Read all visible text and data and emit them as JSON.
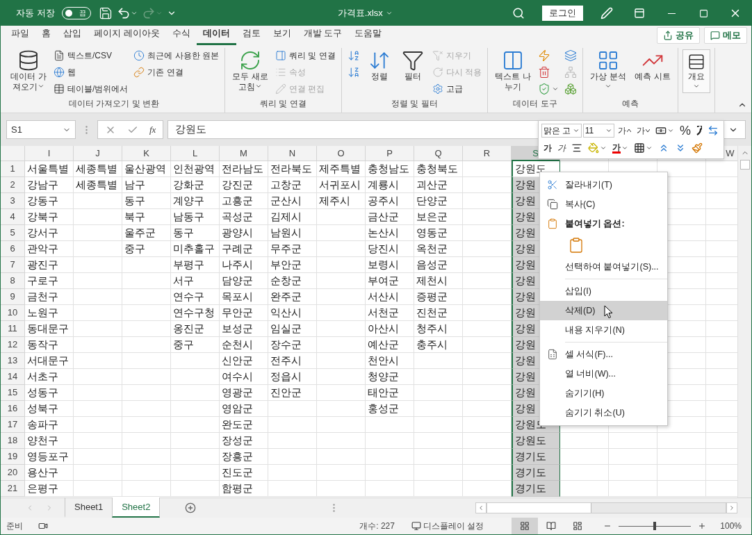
{
  "title_bar": {
    "autosave_label": "자동 저장",
    "autosave": {
      "on": false,
      "label": "끔"
    },
    "redo_disabled": true,
    "title": "가격표.xlsx",
    "login": "로그인"
  },
  "ribbon_tabs": [
    {
      "label": "파일",
      "selected": false
    },
    {
      "label": "홈",
      "selected": false
    },
    {
      "label": "삽입",
      "selected": false
    },
    {
      "label": "페이지 레이아웃",
      "selected": false
    },
    {
      "label": "수식",
      "selected": false
    },
    {
      "label": "데이터",
      "selected": true
    },
    {
      "label": "검토",
      "selected": false
    },
    {
      "label": "보기",
      "selected": false
    },
    {
      "label": "개발 도구",
      "selected": false
    },
    {
      "label": "도움말",
      "selected": false
    }
  ],
  "share": "공유",
  "memo": "메모",
  "ribbon_groups": [
    {
      "label": "데이터 가져오기 및 변환",
      "columns": [
        [
          {
            "kind": "big",
            "label": "데이터 가져오기",
            "dropdown": true,
            "disabled": false
          }
        ],
        [
          {
            "kind": "small",
            "label": "텍스트/CSV",
            "disabled": false
          },
          {
            "kind": "small",
            "label": "웹",
            "disabled": false
          },
          {
            "kind": "small",
            "label": "테이블/범위에서",
            "disabled": false
          }
        ],
        [
          {
            "kind": "small",
            "label": "최근에 사용한 원본",
            "disabled": false
          },
          {
            "kind": "small",
            "label": "기존 연결",
            "disabled": false
          }
        ]
      ]
    },
    {
      "label": "쿼리 및 연결",
      "columns": [
        [
          {
            "kind": "big",
            "label": "모두 새로 고침",
            "dropdown": true,
            "disabled": false
          }
        ],
        [
          {
            "kind": "small",
            "label": "쿼리 및 연결",
            "disabled": false
          },
          {
            "kind": "small",
            "label": "속성",
            "disabled": true
          },
          {
            "kind": "small",
            "label": "연결 편집",
            "disabled": true
          }
        ]
      ]
    },
    {
      "label": "정렬 및 필터",
      "columns": [
        [
          {
            "kind": "icon",
            "disabled": false
          },
          {
            "kind": "icon",
            "disabled": false
          }
        ],
        [
          {
            "kind": "big",
            "label": "정렬",
            "disabled": false
          }
        ],
        [
          {
            "kind": "big",
            "label": "필터",
            "disabled": false
          }
        ],
        [
          {
            "kind": "small",
            "label": "지우기",
            "disabled": true
          },
          {
            "kind": "small",
            "label": "다시 적용",
            "disabled": true
          },
          {
            "kind": "small",
            "label": "고급",
            "disabled": false
          }
        ]
      ]
    },
    {
      "label": "데이터 도구",
      "columns": [
        [
          {
            "kind": "big",
            "label": "텍스트 나누기",
            "disabled": false
          }
        ],
        [
          {
            "kind": "icon",
            "disabled": false
          },
          {
            "kind": "icon",
            "disabled": false
          },
          {
            "kind": "icon",
            "dropdown": true,
            "disabled": false
          }
        ],
        [
          {
            "kind": "icon",
            "disabled": false
          },
          {
            "kind": "icon",
            "disabled": true
          },
          {
            "kind": "icon",
            "disabled": false
          }
        ]
      ]
    },
    {
      "label": "예측",
      "columns": [
        [
          {
            "kind": "big",
            "label": "가상 분석",
            "dropdown": true,
            "disabled": false
          }
        ],
        [
          {
            "kind": "big",
            "label": "예측 시트",
            "disabled": false
          }
        ]
      ]
    },
    {
      "columns": [
        [
          {
            "kind": "boxed",
            "label": "개요",
            "dropdown": true,
            "disabled": false
          }
        ]
      ]
    }
  ],
  "formula_bar": {
    "name_box": "S1",
    "function_label": "fx",
    "value": "강원도"
  },
  "mini_toolbar": {
    "font": "맑은 고",
    "size": "11",
    "row1": [
      {
        "kind": "grow",
        "label": "가"
      },
      {
        "kind": "shrink",
        "label": "가"
      },
      {
        "kind": "accounting"
      },
      {
        "kind": "percent",
        "label": "%"
      },
      {
        "kind": "comma"
      },
      {
        "kind": "merge"
      }
    ],
    "row2": [
      {
        "kind": "bold",
        "label": "가"
      },
      {
        "kind": "italic",
        "label": "가"
      },
      {
        "kind": "align"
      },
      {
        "kind": "fill"
      },
      {
        "kind": "font-color",
        "label": "가"
      },
      {
        "kind": "border"
      },
      {
        "kind": "inc-decimal"
      },
      {
        "kind": "dec-decimal"
      },
      {
        "kind": "painter"
      }
    ]
  },
  "columns": [
    {
      "label": "I",
      "selected": false
    },
    {
      "label": "J",
      "selected": false
    },
    {
      "label": "K",
      "selected": false
    },
    {
      "label": "L",
      "selected": false
    },
    {
      "label": "M",
      "selected": false
    },
    {
      "label": "N",
      "selected": false
    },
    {
      "label": "O",
      "selected": false
    },
    {
      "label": "P",
      "selected": false
    },
    {
      "label": "Q",
      "selected": false
    },
    {
      "label": "R",
      "selected": false
    },
    {
      "label": "S",
      "selected": true
    },
    {
      "selected": false
    },
    {
      "selected": false
    },
    {
      "selected": false
    },
    {
      "label": "W",
      "selected": false
    }
  ],
  "rows": [
    {
      "number": "1",
      "cells": [
        "서울특별",
        "세종특별",
        "울산광역",
        "인천광역",
        "전라남도",
        "전라북도",
        "제주특별",
        "충청남도",
        "충청북도",
        null,
        "강원도"
      ]
    },
    {
      "number": "2",
      "cells": [
        "강남구",
        "세종특별",
        "남구",
        "강화군",
        "강진군",
        "고창군",
        "서귀포시",
        "계룡시",
        "괴산군",
        null,
        "강원"
      ]
    },
    {
      "number": "3",
      "cells": [
        "강동구",
        null,
        "동구",
        "계양구",
        "고흥군",
        "군산시",
        "제주시",
        "공주시",
        "단양군",
        null,
        "강원"
      ]
    },
    {
      "number": "4",
      "cells": [
        "강북구",
        null,
        "북구",
        "남동구",
        "곡성군",
        "김제시",
        null,
        "금산군",
        "보은군",
        null,
        "강원"
      ]
    },
    {
      "number": "5",
      "cells": [
        "강서구",
        null,
        "울주군",
        "동구",
        "광양시",
        "남원시",
        null,
        "논산시",
        "영동군",
        null,
        "강원"
      ]
    },
    {
      "number": "6",
      "cells": [
        "관악구",
        null,
        "중구",
        "미추홀구",
        "구례군",
        "무주군",
        null,
        "당진시",
        "옥천군",
        null,
        "강원"
      ]
    },
    {
      "number": "7",
      "cells": [
        "광진구",
        null,
        null,
        "부평구",
        "나주시",
        "부안군",
        null,
        "보령시",
        "음성군",
        null,
        "강원"
      ]
    },
    {
      "number": "8",
      "cells": [
        "구로구",
        null,
        null,
        "서구",
        "담양군",
        "순창군",
        null,
        "부여군",
        "제천시",
        null,
        "강원"
      ]
    },
    {
      "number": "9",
      "cells": [
        "금천구",
        null,
        null,
        "연수구",
        "목포시",
        "완주군",
        null,
        "서산시",
        "증평군",
        null,
        "강원"
      ]
    },
    {
      "number": "10",
      "cells": [
        "노원구",
        null,
        null,
        "연수구청",
        "무안군",
        "익산시",
        null,
        "서천군",
        "진천군",
        null,
        "강원"
      ]
    },
    {
      "number": "11",
      "cells": [
        "동대문구",
        null,
        null,
        "옹진군",
        "보성군",
        "임실군",
        null,
        "아산시",
        "청주시",
        null,
        "강원"
      ]
    },
    {
      "number": "12",
      "cells": [
        "동작구",
        null,
        null,
        "중구",
        "순천시",
        "장수군",
        null,
        "예산군",
        "충주시",
        null,
        "강원"
      ]
    },
    {
      "number": "13",
      "cells": [
        "서대문구",
        null,
        null,
        null,
        "신안군",
        "전주시",
        null,
        "천안시",
        null,
        null,
        "강원"
      ]
    },
    {
      "number": "14",
      "cells": [
        "서초구",
        null,
        null,
        null,
        "여수시",
        "정읍시",
        null,
        "청양군",
        null,
        null,
        "강원"
      ]
    },
    {
      "number": "15",
      "cells": [
        "성동구",
        null,
        null,
        null,
        "영광군",
        "진안군",
        null,
        "태안군",
        null,
        null,
        "강원"
      ]
    },
    {
      "number": "16",
      "cells": [
        "성북구",
        null,
        null,
        null,
        "영암군",
        null,
        null,
        "홍성군",
        null,
        null,
        "강원"
      ]
    },
    {
      "number": "17",
      "cells": [
        "송파구",
        null,
        null,
        null,
        "완도군",
        null,
        null,
        null,
        null,
        null,
        "강원도"
      ]
    },
    {
      "number": "18",
      "cells": [
        "양천구",
        null,
        null,
        null,
        "장성군",
        null,
        null,
        null,
        null,
        null,
        "강원도"
      ]
    },
    {
      "number": "19",
      "cells": [
        "영등포구",
        null,
        null,
        null,
        "장흥군",
        null,
        null,
        null,
        null,
        null,
        "경기도"
      ]
    },
    {
      "number": "20",
      "cells": [
        "용산구",
        null,
        null,
        null,
        "진도군",
        null,
        null,
        null,
        null,
        null,
        "경기도"
      ]
    },
    {
      "number": "21",
      "cells": [
        "은평구",
        null,
        null,
        null,
        "함평군",
        null,
        null,
        null,
        null,
        null,
        "경기도"
      ]
    }
  ],
  "context_menu": [
    {
      "kind": "item",
      "label": "잘라내기(T)",
      "selected": false
    },
    {
      "kind": "item",
      "label": "복사(C)",
      "selected": false
    },
    {
      "kind": "header",
      "label": "붙여넣기 옵션:"
    },
    {
      "kind": "paste-option",
      "selected": false
    },
    {
      "kind": "item",
      "label": "선택하여 붙여넣기(S)...",
      "selected": false
    },
    {
      "kind": "separator"
    },
    {
      "kind": "item",
      "label": "삽입(I)",
      "selected": false
    },
    {
      "kind": "item",
      "label": "삭제(D)",
      "selected": true
    },
    {
      "kind": "item",
      "label": "내용 지우기(N)",
      "selected": false
    },
    {
      "kind": "separator"
    },
    {
      "kind": "item",
      "label": "셀 서식(F)...",
      "selected": false
    },
    {
      "kind": "item",
      "label": "열 너비(W)...",
      "selected": false
    },
    {
      "kind": "item",
      "label": "숨기기(H)",
      "selected": false
    },
    {
      "kind": "item",
      "label": "숨기기 취소(U)",
      "selected": false
    }
  ],
  "sheet_tabs": [
    {
      "label": "Sheet1",
      "selected": false
    },
    {
      "label": "Sheet2",
      "selected": true
    }
  ],
  "status_bar": {
    "ready": "준비",
    "count": "개수: 227",
    "display_settings": "디스플레이 설정",
    "views": [
      {
        "kind": "normal",
        "selected": true
      },
      {
        "kind": "page-layout",
        "selected": false
      },
      {
        "kind": "page-break",
        "selected": false
      }
    ],
    "zoom": {
      "level": 0.5,
      "label": "100%"
    }
  }
}
